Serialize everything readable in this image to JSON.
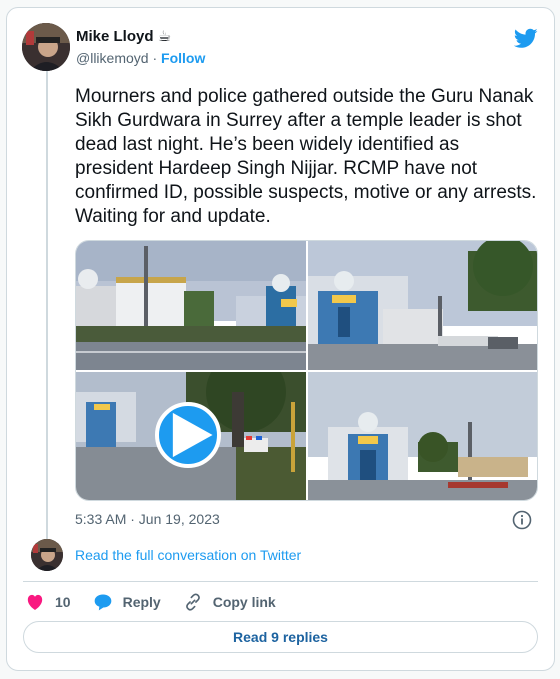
{
  "author": {
    "name": "Mike Lloyd",
    "emoji": "☕",
    "handle": "@llikemoyd",
    "separator": "·",
    "follow_label": "Follow"
  },
  "tweet": {
    "text": "Mourners and police gathered outside the Guru Nanak Sikh Gurdwara in Surrey after a temple leader is shot dead last night. He’s been widely identified as president Hardeep Singh Nijjar. RCMP have not confirmed ID, possible suspects, motive or any arrests. Waiting for and update.",
    "timestamp": "5:33 AM · Jun 19, 2023"
  },
  "media": {
    "images": [
      "temple-street-view",
      "temple-with-police-tape",
      "police-car-video",
      "temple-mourners"
    ],
    "video_index": 2
  },
  "conversation": {
    "read_label": "Read the full conversation on Twitter"
  },
  "actions": {
    "likes": "10",
    "reply_label": "Reply",
    "copy_label": "Copy link"
  },
  "footer": {
    "read_replies_label": "Read 9 replies"
  },
  "colors": {
    "twitter_blue": "#1d9bf0",
    "heart_pink": "#f91880",
    "text_secondary": "#536471",
    "border": "#cfd9de"
  }
}
